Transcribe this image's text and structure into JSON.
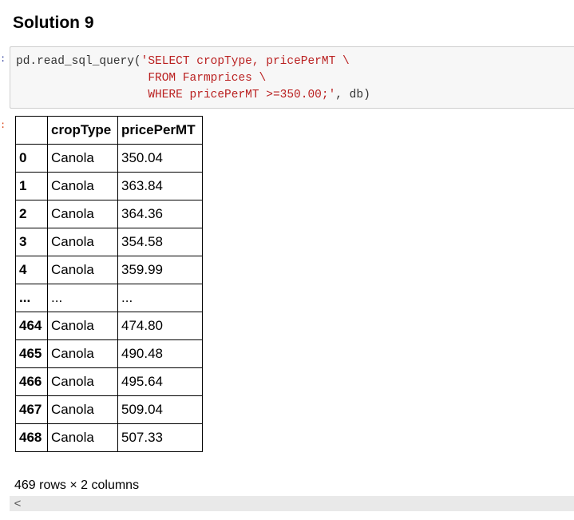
{
  "heading": "Solution 9",
  "code_cell": {
    "in_prompt": ":",
    "line1_plain": "pd.read_sql_query(",
    "line1_string": "'SELECT cropType, pricePerMT \\",
    "line2_string": "FROM Farmprices \\",
    "line3_string": "WHERE pricePerMT >=350.00;'",
    "line3_plain": ", db)"
  },
  "output": {
    "out_prompt": ":",
    "table": {
      "columns": [
        "",
        "cropType",
        "pricePerMT"
      ],
      "rows": [
        {
          "index": "0",
          "cropType": "Canola",
          "pricePerMT": "350.04"
        },
        {
          "index": "1",
          "cropType": "Canola",
          "pricePerMT": "363.84"
        },
        {
          "index": "2",
          "cropType": "Canola",
          "pricePerMT": "364.36"
        },
        {
          "index": "3",
          "cropType": "Canola",
          "pricePerMT": "354.58"
        },
        {
          "index": "4",
          "cropType": "Canola",
          "pricePerMT": "359.99"
        },
        {
          "index": "...",
          "cropType": "...",
          "pricePerMT": "..."
        },
        {
          "index": "464",
          "cropType": "Canola",
          "pricePerMT": "474.80"
        },
        {
          "index": "465",
          "cropType": "Canola",
          "pricePerMT": "490.48"
        },
        {
          "index": "466",
          "cropType": "Canola",
          "pricePerMT": "495.64"
        },
        {
          "index": "467",
          "cropType": "Canola",
          "pricePerMT": "509.04"
        },
        {
          "index": "468",
          "cropType": "Canola",
          "pricePerMT": "507.33"
        }
      ]
    },
    "shape_text": "469 rows × 2 columns"
  },
  "scrollbar": {
    "left_arrow_icon": "chevron-left-icon",
    "left_arrow_glyph": "<"
  }
}
